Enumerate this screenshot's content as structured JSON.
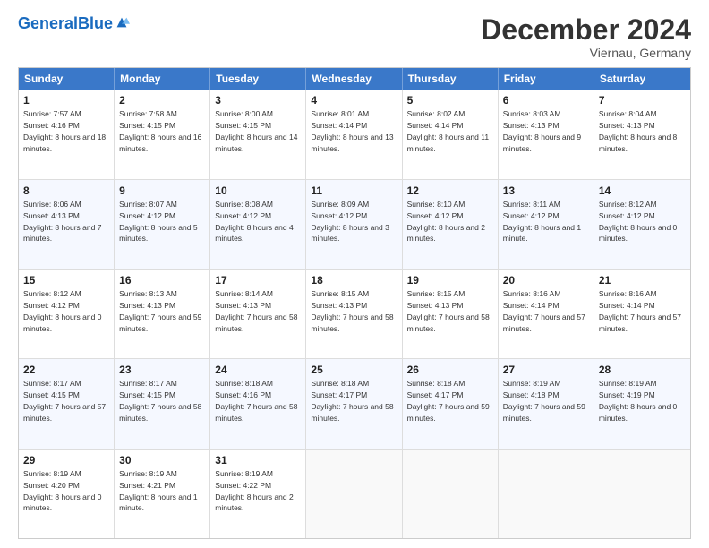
{
  "header": {
    "logo_text_general": "General",
    "logo_text_blue": "Blue",
    "month_title": "December 2024",
    "location": "Viernau, Germany"
  },
  "days_of_week": [
    "Sunday",
    "Monday",
    "Tuesday",
    "Wednesday",
    "Thursday",
    "Friday",
    "Saturday"
  ],
  "weeks": [
    [
      {
        "day": "1",
        "sunrise": "7:57 AM",
        "sunset": "4:16 PM",
        "daylight": "8 hours and 18 minutes."
      },
      {
        "day": "2",
        "sunrise": "7:58 AM",
        "sunset": "4:15 PM",
        "daylight": "8 hours and 16 minutes."
      },
      {
        "day": "3",
        "sunrise": "8:00 AM",
        "sunset": "4:15 PM",
        "daylight": "8 hours and 14 minutes."
      },
      {
        "day": "4",
        "sunrise": "8:01 AM",
        "sunset": "4:14 PM",
        "daylight": "8 hours and 13 minutes."
      },
      {
        "day": "5",
        "sunrise": "8:02 AM",
        "sunset": "4:14 PM",
        "daylight": "8 hours and 11 minutes."
      },
      {
        "day": "6",
        "sunrise": "8:03 AM",
        "sunset": "4:13 PM",
        "daylight": "8 hours and 9 minutes."
      },
      {
        "day": "7",
        "sunrise": "8:04 AM",
        "sunset": "4:13 PM",
        "daylight": "8 hours and 8 minutes."
      }
    ],
    [
      {
        "day": "8",
        "sunrise": "8:06 AM",
        "sunset": "4:13 PM",
        "daylight": "8 hours and 7 minutes."
      },
      {
        "day": "9",
        "sunrise": "8:07 AM",
        "sunset": "4:12 PM",
        "daylight": "8 hours and 5 minutes."
      },
      {
        "day": "10",
        "sunrise": "8:08 AM",
        "sunset": "4:12 PM",
        "daylight": "8 hours and 4 minutes."
      },
      {
        "day": "11",
        "sunrise": "8:09 AM",
        "sunset": "4:12 PM",
        "daylight": "8 hours and 3 minutes."
      },
      {
        "day": "12",
        "sunrise": "8:10 AM",
        "sunset": "4:12 PM",
        "daylight": "8 hours and 2 minutes."
      },
      {
        "day": "13",
        "sunrise": "8:11 AM",
        "sunset": "4:12 PM",
        "daylight": "8 hours and 1 minute."
      },
      {
        "day": "14",
        "sunrise": "8:12 AM",
        "sunset": "4:12 PM",
        "daylight": "8 hours and 0 minutes."
      }
    ],
    [
      {
        "day": "15",
        "sunrise": "8:12 AM",
        "sunset": "4:12 PM",
        "daylight": "8 hours and 0 minutes."
      },
      {
        "day": "16",
        "sunrise": "8:13 AM",
        "sunset": "4:13 PM",
        "daylight": "7 hours and 59 minutes."
      },
      {
        "day": "17",
        "sunrise": "8:14 AM",
        "sunset": "4:13 PM",
        "daylight": "7 hours and 58 minutes."
      },
      {
        "day": "18",
        "sunrise": "8:15 AM",
        "sunset": "4:13 PM",
        "daylight": "7 hours and 58 minutes."
      },
      {
        "day": "19",
        "sunrise": "8:15 AM",
        "sunset": "4:13 PM",
        "daylight": "7 hours and 58 minutes."
      },
      {
        "day": "20",
        "sunrise": "8:16 AM",
        "sunset": "4:14 PM",
        "daylight": "7 hours and 57 minutes."
      },
      {
        "day": "21",
        "sunrise": "8:16 AM",
        "sunset": "4:14 PM",
        "daylight": "7 hours and 57 minutes."
      }
    ],
    [
      {
        "day": "22",
        "sunrise": "8:17 AM",
        "sunset": "4:15 PM",
        "daylight": "7 hours and 57 minutes."
      },
      {
        "day": "23",
        "sunrise": "8:17 AM",
        "sunset": "4:15 PM",
        "daylight": "7 hours and 58 minutes."
      },
      {
        "day": "24",
        "sunrise": "8:18 AM",
        "sunset": "4:16 PM",
        "daylight": "7 hours and 58 minutes."
      },
      {
        "day": "25",
        "sunrise": "8:18 AM",
        "sunset": "4:17 PM",
        "daylight": "7 hours and 58 minutes."
      },
      {
        "day": "26",
        "sunrise": "8:18 AM",
        "sunset": "4:17 PM",
        "daylight": "7 hours and 59 minutes."
      },
      {
        "day": "27",
        "sunrise": "8:19 AM",
        "sunset": "4:18 PM",
        "daylight": "7 hours and 59 minutes."
      },
      {
        "day": "28",
        "sunrise": "8:19 AM",
        "sunset": "4:19 PM",
        "daylight": "8 hours and 0 minutes."
      }
    ],
    [
      {
        "day": "29",
        "sunrise": "8:19 AM",
        "sunset": "4:20 PM",
        "daylight": "8 hours and 0 minutes."
      },
      {
        "day": "30",
        "sunrise": "8:19 AM",
        "sunset": "4:21 PM",
        "daylight": "8 hours and 1 minute."
      },
      {
        "day": "31",
        "sunrise": "8:19 AM",
        "sunset": "4:22 PM",
        "daylight": "8 hours and 2 minutes."
      },
      null,
      null,
      null,
      null
    ]
  ]
}
